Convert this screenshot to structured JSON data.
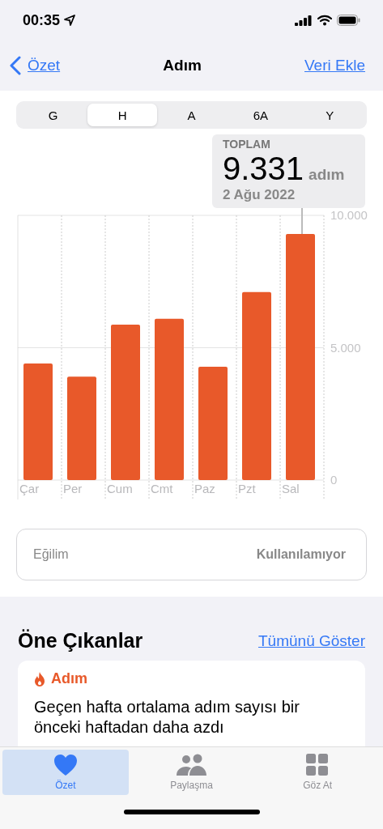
{
  "status_bar": {
    "time": "00:35"
  },
  "nav": {
    "back": "Özet",
    "title": "Adım",
    "action": "Veri Ekle"
  },
  "segments": [
    {
      "label": "G",
      "selected": false
    },
    {
      "label": "H",
      "selected": true
    },
    {
      "label": "A",
      "selected": false
    },
    {
      "label": "6A",
      "selected": false
    },
    {
      "label": "Y",
      "selected": false
    }
  ],
  "tooltip": {
    "label": "TOPLAM",
    "value": "9.331",
    "unit": "adım",
    "date": "2 Ağu 2022"
  },
  "chart_data": {
    "type": "bar",
    "categories": [
      "Çar",
      "Per",
      "Cum",
      "Cmt",
      "Paz",
      "Pzt",
      "Sal"
    ],
    "values": [
      4400,
      3910,
      5870,
      6090,
      4280,
      7100,
      9300
    ],
    "ylim": [
      0,
      10000
    ],
    "yticks": [
      {
        "value": 0,
        "label": "0"
      },
      {
        "value": 5000,
        "label": "5.000"
      },
      {
        "value": 10000,
        "label": "10.000"
      }
    ]
  },
  "trend": {
    "label": "Eğilim",
    "value": "Kullanılamıyor"
  },
  "highlights": {
    "title": "Öne Çıkanlar",
    "link": "Tümünü Göster",
    "card": {
      "category": "Adım",
      "text": "Geçen hafta ortalama adım sayısı bir önceki haftadan daha azdı"
    }
  },
  "tab_bar": [
    {
      "label": "Özet",
      "kind": "heart",
      "selected": true
    },
    {
      "label": "Paylaşma",
      "kind": "people",
      "selected": false
    },
    {
      "label": "Göz At",
      "kind": "grid",
      "selected": false
    }
  ]
}
